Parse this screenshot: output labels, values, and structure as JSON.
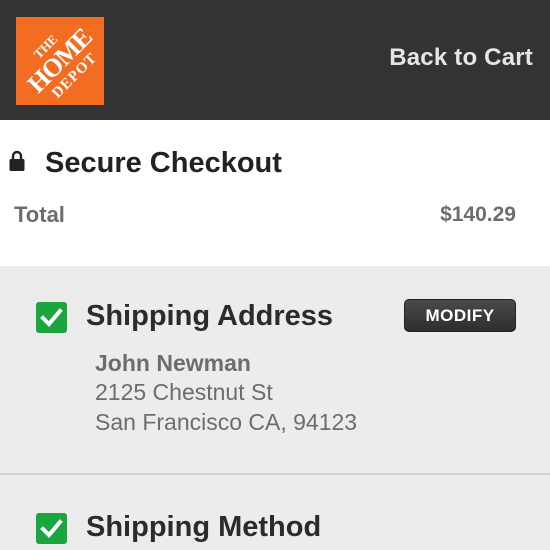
{
  "header": {
    "logo": {
      "name": "home-depot-logo",
      "lines": [
        "THE",
        "HOME",
        "DEPOT"
      ],
      "color": "#f26d21"
    },
    "back_link": "Back to Cart"
  },
  "summary": {
    "title": "Secure Checkout",
    "total_label": "Total",
    "total_value": "$140.29"
  },
  "shipping_address": {
    "title": "Shipping Address",
    "checked": true,
    "modify_label": "MODIFY",
    "name": "John Newman",
    "street": "2125 Chestnut St",
    "city": "San Francisco CA, 94123"
  },
  "shipping_method": {
    "title": "Shipping Method",
    "checked": true
  },
  "colors": {
    "header_bg": "#333333",
    "accent_orange": "#f26d21",
    "check_green": "#1ba53f"
  }
}
